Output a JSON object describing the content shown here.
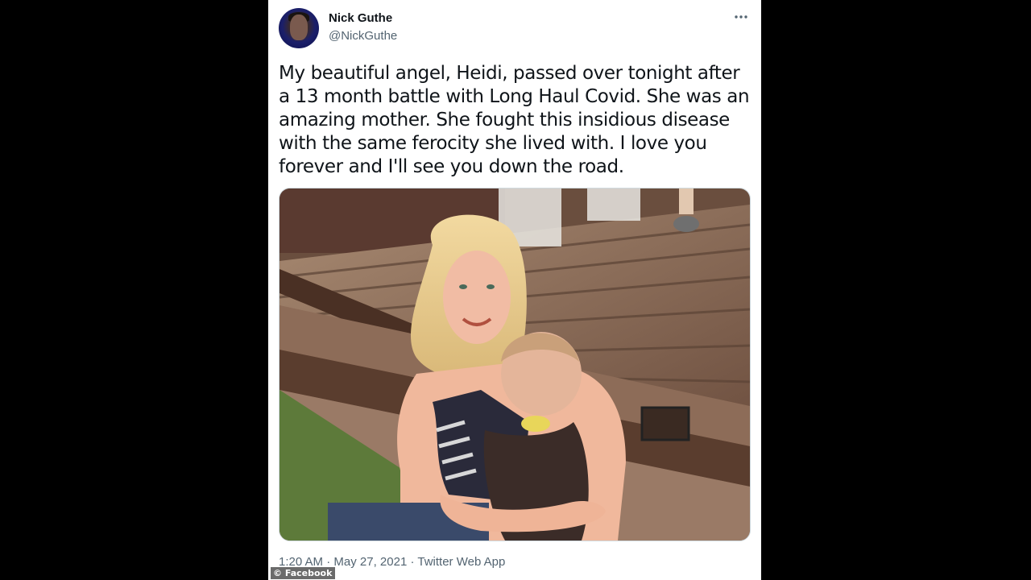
{
  "tweet": {
    "author_name": "Nick Guthe",
    "author_handle": "@NickGuthe",
    "more_icon": "more-horizontal-icon",
    "text": "My beautiful angel, Heidi, passed over tonight after a 13 month battle with Long Haul Covid. She was an amazing mother. She fought this insidious disease with the same ferocity she lived with. I love you forever and I'll see you down the road.",
    "time": "1:20 AM",
    "separator": "·",
    "date": "May 27, 2021",
    "source": "Twitter Web App"
  },
  "overlay": {
    "source_credit": "© Facebook"
  },
  "colors": {
    "background": "#000000",
    "card": "#ffffff",
    "text_primary": "#0f1419",
    "text_secondary": "#536471"
  }
}
